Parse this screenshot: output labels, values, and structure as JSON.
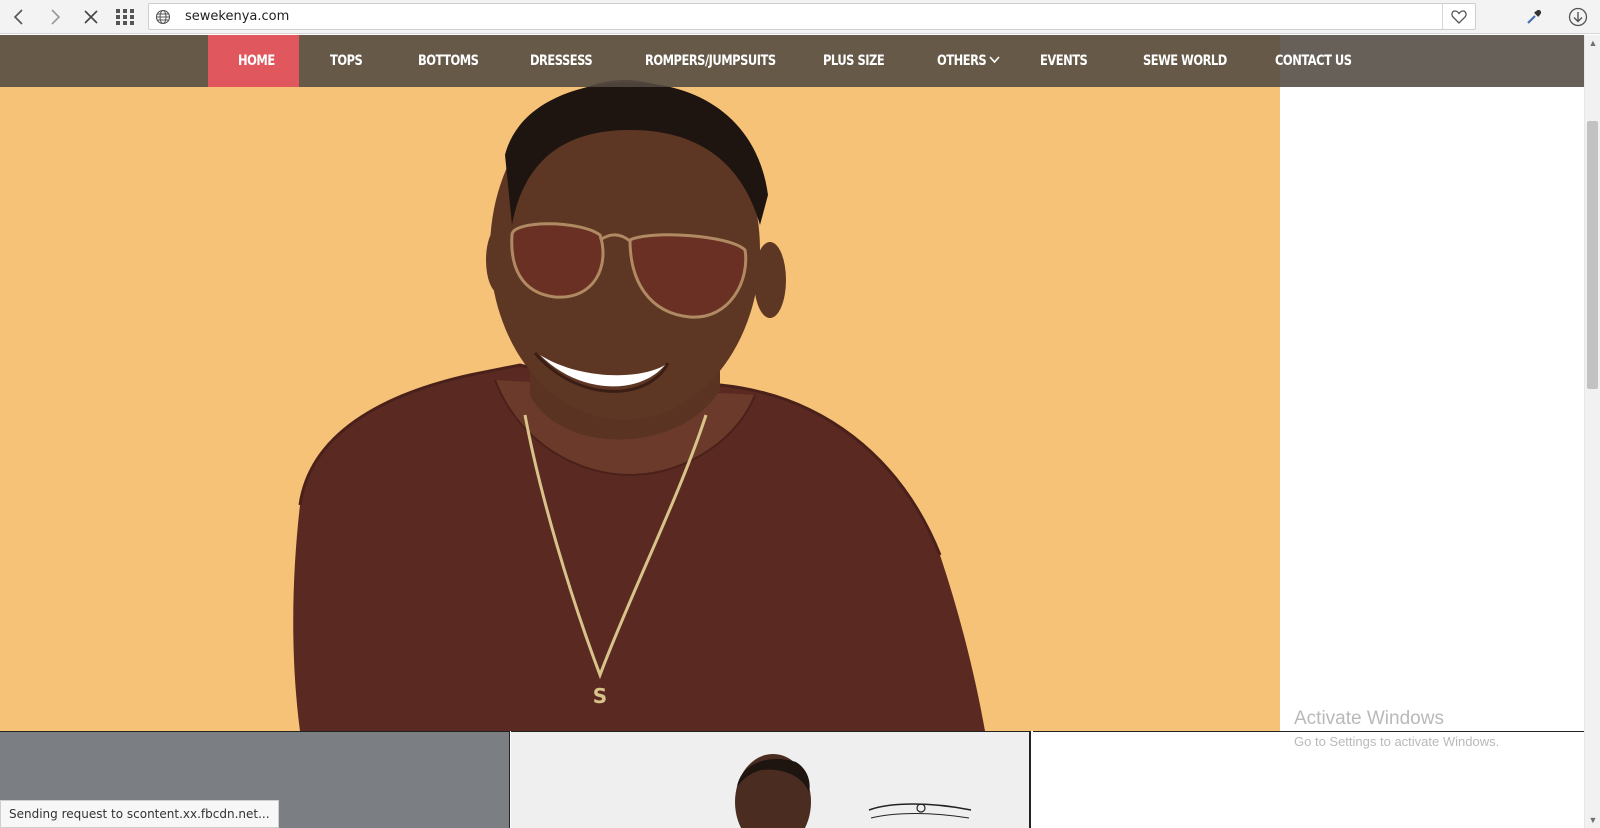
{
  "browser": {
    "url": "sewekenya.com",
    "icons": [
      "back-icon",
      "forward-icon",
      "stop-loading-icon",
      "speed-dial-icon",
      "globe-icon",
      "heart-icon",
      "eyedropper-icon",
      "download-icon"
    ]
  },
  "site_nav": {
    "items": [
      {
        "label": "HOME",
        "active": true
      },
      {
        "label": "TOPS"
      },
      {
        "label": "BOTTOMS"
      },
      {
        "label": "DRESSESS"
      },
      {
        "label": "ROMPERS/JUMPSUITS"
      },
      {
        "label": "PLUS SIZE"
      },
      {
        "label": "OTHERS",
        "has_dropdown": true
      },
      {
        "label": "EVENTS"
      },
      {
        "label": "SEWE WORLD"
      },
      {
        "label": "CONTACT US"
      }
    ],
    "active_color": "#e0585e",
    "bar_color": "#524a42"
  },
  "hero": {
    "background_color": "#f6c277",
    "pendant_letter": "S"
  },
  "windows_watermark": {
    "title": "Activate Windows",
    "subtitle": "Go to Settings to activate Windows."
  },
  "status_bar": {
    "text": "Sending request to scontent.xx.fbcdn.net..."
  }
}
